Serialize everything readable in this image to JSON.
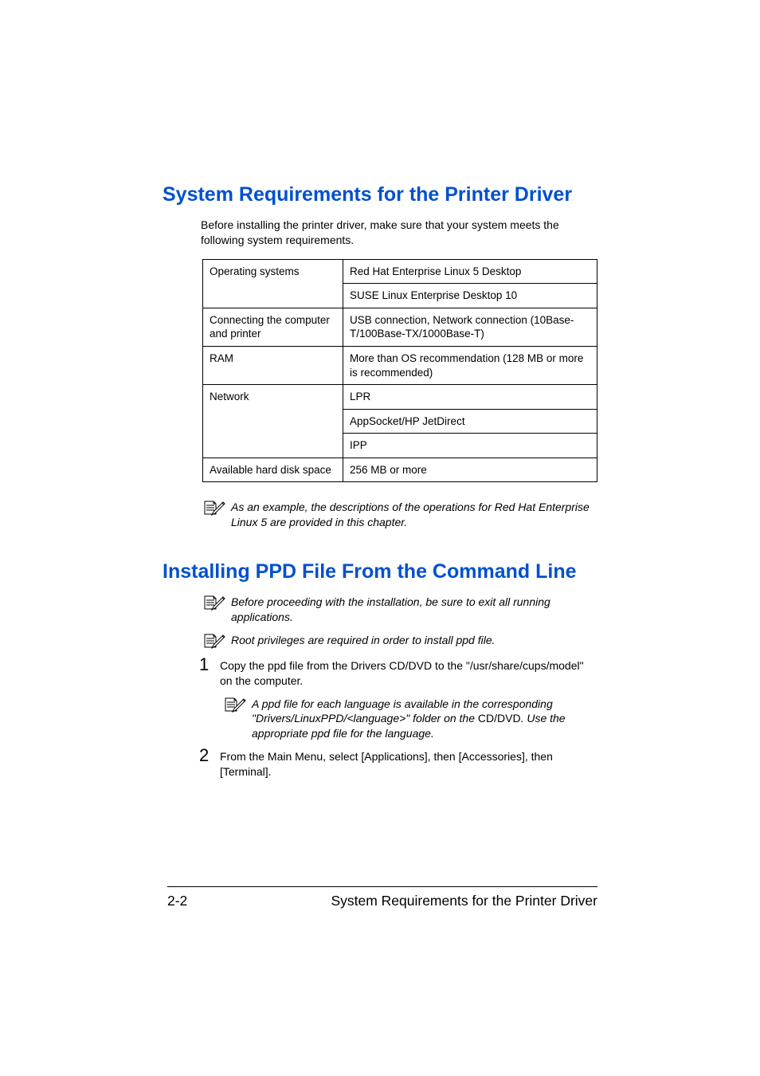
{
  "heading1": "System Requirements for the Printer Driver",
  "intro1": "Before installing the printer driver, make sure that your system meets the following system requirements.",
  "table": {
    "r1_label": "Operating systems",
    "r1_val1": "Red Hat Enterprise Linux 5 Desktop",
    "r1_val2": "SUSE Linux Enterprise Desktop 10",
    "r2_label": "Connecting the computer and printer",
    "r2_val": "USB connection, Network connection (10Base-T/100Base-TX/1000Base-T)",
    "r3_label": "RAM",
    "r3_val": "More than OS recommendation (128 MB or more is recommended)",
    "r4_label": "Network",
    "r4_val1": "LPR",
    "r4_val2": "AppSocket/HP JetDirect",
    "r4_val3": "IPP",
    "r5_label": "Available hard disk space",
    "r5_val": "256 MB or more"
  },
  "note1": "As an example, the descriptions of the operations for Red Hat Enterprise Linux 5 are provided in this chapter.",
  "heading2": "Installing PPD File From the Command Line",
  "note2": "Before proceeding with the installation, be sure to exit all running applications.",
  "note3": "Root privileges are required in order to install ppd file.",
  "step1_num": "1",
  "step1_text": "Copy the ppd file from the Drivers CD/DVD to the \"/usr/share/cups/model\" on the computer.",
  "subnote_a": "A ppd file for each language is available in the corresponding \"Drivers/LinuxPPD/<language>\" folder on the ",
  "subnote_b": "CD/DVD",
  "subnote_c": ". Use the appropriate ppd file for the language.",
  "step2_num": "2",
  "step2_text": "From the Main Menu, select [Applications], then [Accessories], then [Terminal].",
  "footer_page": "2-2",
  "footer_title": "System Requirements for the Printer Driver"
}
